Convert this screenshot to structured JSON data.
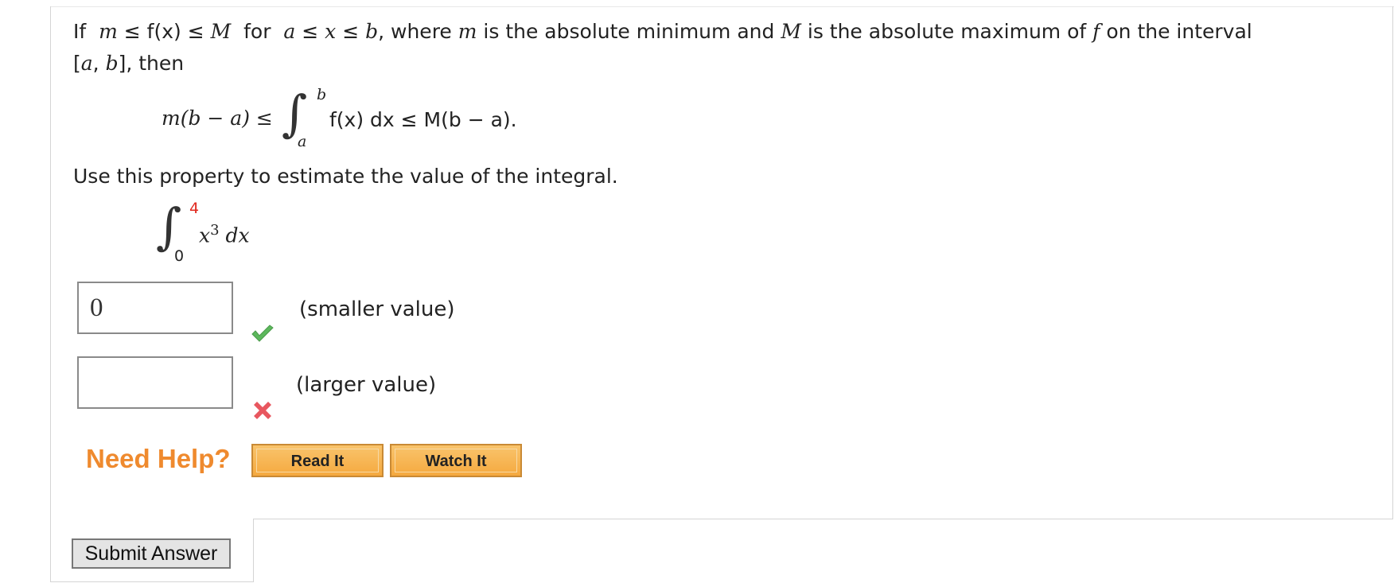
{
  "problem": {
    "intro_if": "If",
    "intro_m": "m",
    "intro_le1": " ≤ ",
    "intro_fx": "f(x)",
    "intro_le2": " ≤ ",
    "intro_M": "M",
    "intro_for": " for ",
    "intro_a": "a",
    "intro_le3": " ≤ ",
    "intro_x": "x",
    "intro_le4": " ≤ ",
    "intro_b": "b",
    "intro_rest1": ", where ",
    "intro_m2": "m",
    "intro_rest2": " is the absolute minimum and ",
    "intro_M2": "M",
    "intro_rest3": " is the absolute maximum of ",
    "intro_f": "f",
    "intro_rest4": " on the interval",
    "line2_open": "[",
    "line2_a": "a",
    "line2_comma": ", ",
    "line2_b": "b",
    "line2_close": "], then",
    "ineq_left": "m(b − a) ≤",
    "ineq_upper": "b",
    "ineq_lower": "a",
    "ineq_integrand": "f(x) dx ≤ M(b − a).",
    "instruction": "Use this property to estimate the value of the integral.",
    "integral_upper": "4",
    "integral_lower": "0",
    "integrand_base": "x",
    "integrand_exp": "3",
    "integrand_dx": "dx"
  },
  "answers": [
    {
      "value": "0",
      "label": "(smaller value)",
      "status": "correct",
      "status_icon": "check-icon",
      "status_color": "#5cb85c"
    },
    {
      "value": "",
      "label": "(larger value)",
      "status": "incorrect",
      "status_icon": "cross-icon",
      "status_color": "#e8575f"
    }
  ],
  "help": {
    "title": "Need Help?",
    "read_it": "Read It",
    "watch_it": "Watch It"
  },
  "submit_label": "Submit Answer",
  "colors": {
    "need_help": "#ef8a2e",
    "button_fill": "#f5a93f",
    "limit_red": "#e0281e"
  }
}
